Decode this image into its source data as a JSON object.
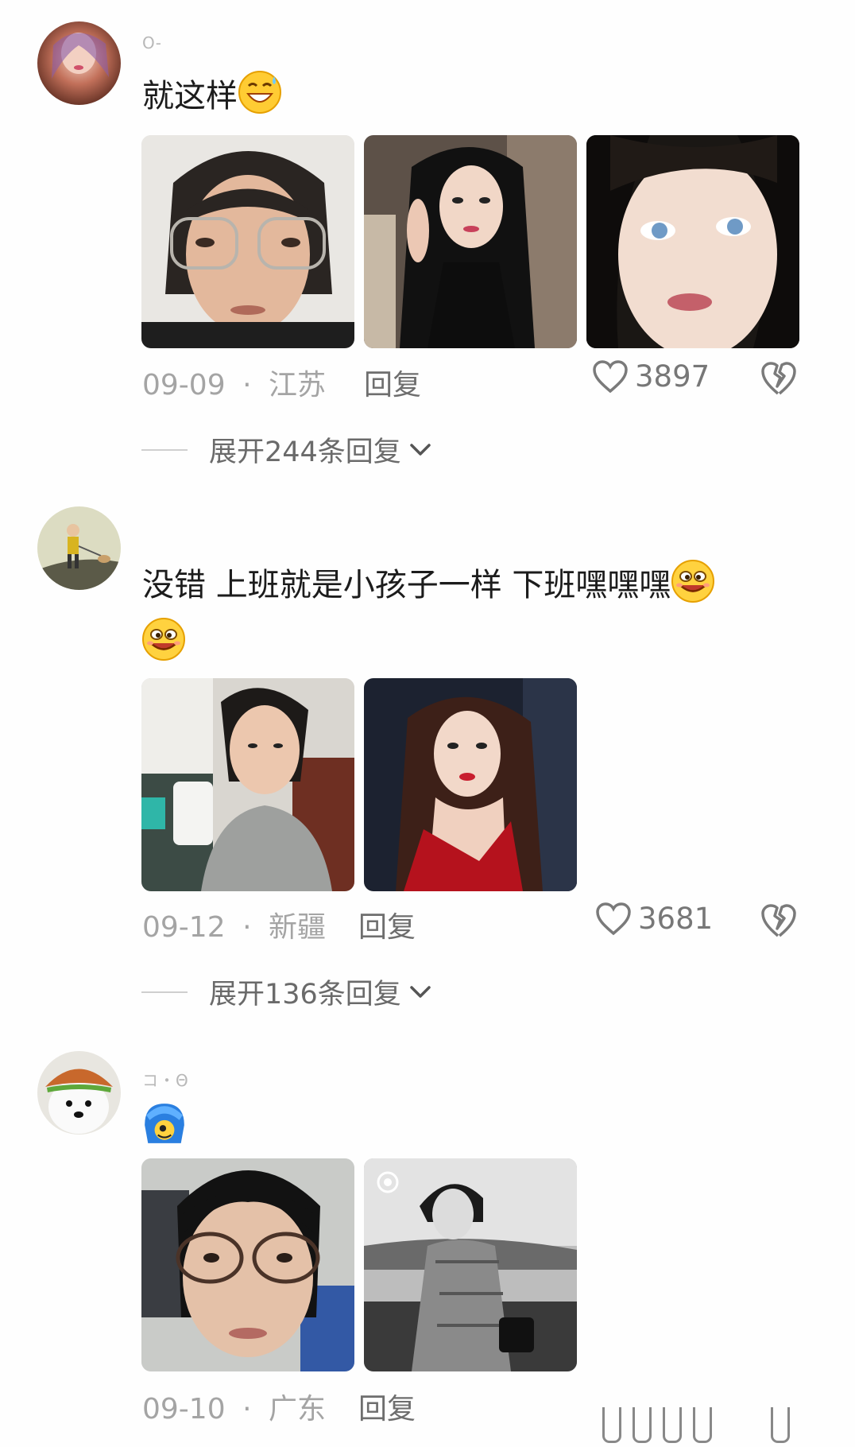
{
  "comments": [
    {
      "username": "O‐",
      "text": "就这样",
      "emoji": "grinning-sweat-emoji",
      "date": "09-09",
      "location": "江苏",
      "reply_label": "回复",
      "likes": "3897",
      "expand_label": "展开244条回复",
      "photos": [
        "selfie-glasses-photo",
        "curly-hair-woman-photo",
        "blue-eyes-closeup-photo"
      ]
    },
    {
      "username": "",
      "text": "没错 上班就是小孩子一样 下班嘿嘿嘿",
      "emoji": "silly-smile-emoji",
      "date": "09-12",
      "location": "新疆",
      "reply_label": "回复",
      "likes": "3681",
      "expand_label": "展开136条回复",
      "photos": [
        "office-selfie-photo",
        "red-dress-woman-photo"
      ]
    },
    {
      "username": "コ・Θ",
      "text": "",
      "emoji": "blue-hair-sticker",
      "date": "09-10",
      "location": "广东",
      "reply_label": "回复",
      "photos": [
        "bob-hair-glasses-photo",
        "qipao-bw-photo"
      ]
    }
  ],
  "separator": "·",
  "colors": {
    "text": "#1c1c1c",
    "meta": "#a4a4a4",
    "reply": "#6e6e6e",
    "background": "#fefefe"
  }
}
